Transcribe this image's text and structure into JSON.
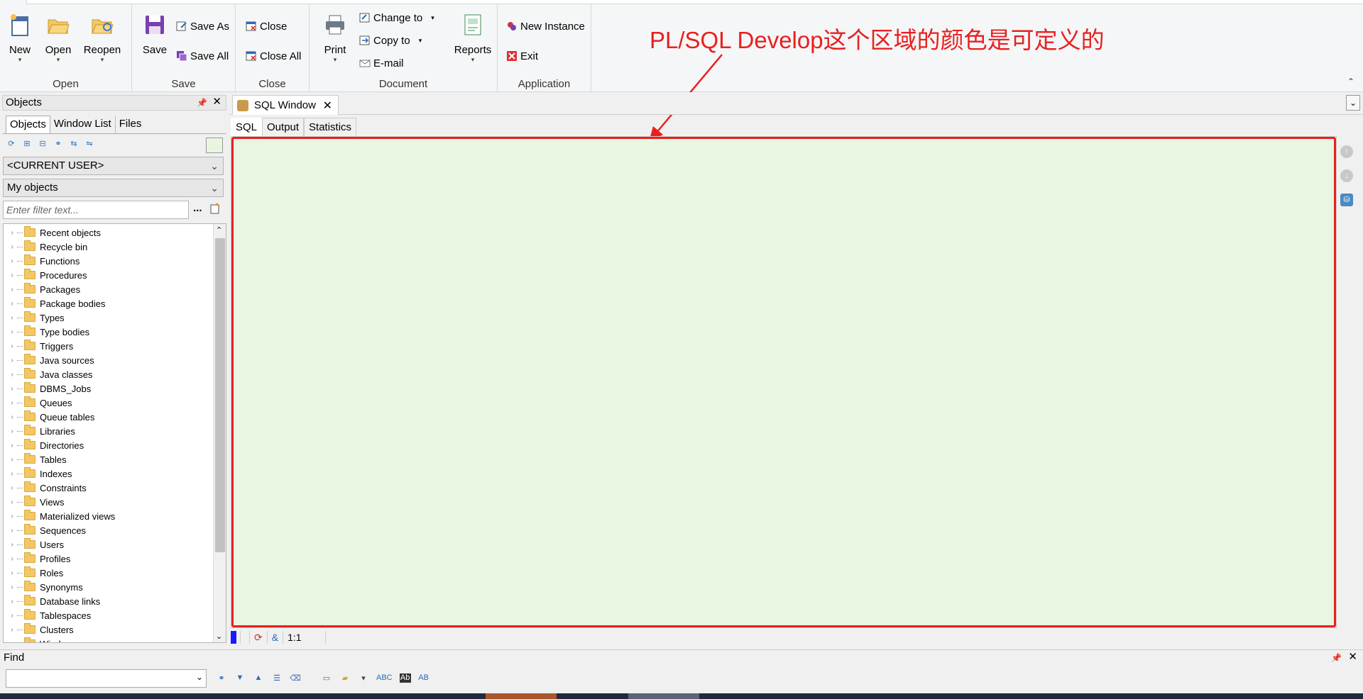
{
  "ribbon": {
    "groups": {
      "open": "Open",
      "save": "Save",
      "close": "Close",
      "document": "Document",
      "application": "Application"
    },
    "buttons": {
      "new": "New",
      "open": "Open",
      "reopen": "Reopen",
      "save": "Save",
      "save_as": "Save As",
      "save_all": "Save All",
      "close": "Close",
      "close_all": "Close All",
      "print": "Print",
      "change_to": "Change to",
      "copy_to": "Copy to",
      "email": "E-mail",
      "reports": "Reports",
      "new_instance": "New Instance",
      "exit": "Exit"
    }
  },
  "annotation": "PL/SQL Develop这个区域的颜色是可定义的",
  "objects_panel": {
    "title": "Objects",
    "tabs": [
      "Objects",
      "Window List",
      "Files"
    ],
    "user_combo": "<CURRENT USER>",
    "scope_combo": "My objects",
    "filter_placeholder": "Enter filter text...",
    "filter_dots": "...",
    "tree_items": [
      "Recent objects",
      "Recycle bin",
      "Functions",
      "Procedures",
      "Packages",
      "Package bodies",
      "Types",
      "Type bodies",
      "Triggers",
      "Java sources",
      "Java classes",
      "DBMS_Jobs",
      "Queues",
      "Queue tables",
      "Libraries",
      "Directories",
      "Tables",
      "Indexes",
      "Constraints",
      "Views",
      "Materialized views",
      "Sequences",
      "Users",
      "Profiles",
      "Roles",
      "Synonyms",
      "Database links",
      "Tablespaces",
      "Clusters",
      "Window groups"
    ]
  },
  "sql_window": {
    "tab_title": "SQL Window",
    "tabs": [
      "SQL",
      "Output",
      "Statistics"
    ],
    "editor_bg": "#e9f6e1",
    "highlight_color": "#e8201f",
    "status": {
      "ampersand": "&",
      "position": "1:1"
    }
  },
  "find_panel": {
    "title": "Find",
    "tool_labels": [
      "ABC",
      "Ab",
      "AB"
    ]
  }
}
